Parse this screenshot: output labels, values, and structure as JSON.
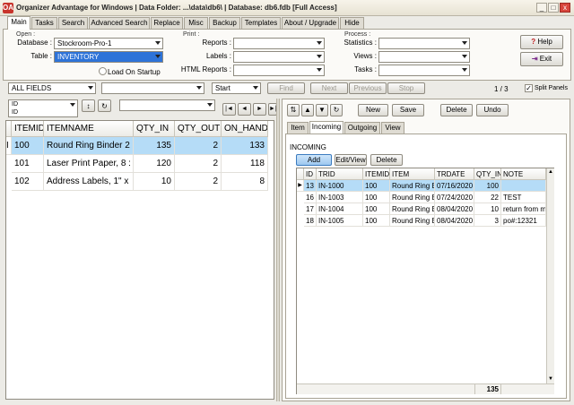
{
  "window": {
    "title": "Organizer Advantage for Windows | Data Folder: ...\\data\\db6\\ | Database: db6.fdb [Full Access]",
    "app_icon": "OA",
    "minimize": "_",
    "maximize": "□",
    "close": "x"
  },
  "tabs": [
    "Main",
    "Tasks",
    "Search",
    "Advanced Search",
    "Replace",
    "Misc",
    "Backup",
    "Templates",
    "About / Upgrade",
    "Hide"
  ],
  "main_panel": {
    "open_group": "Open :",
    "database_label": "Database :",
    "database_value": "Stockroom-Pro-1",
    "table_label": "Table :",
    "table_value": "INVENTORY",
    "load_on_startup": "Load On Startup",
    "print_group": "Print :",
    "reports_label": "Reports :",
    "labels_label": "Labels :",
    "html_reports_label": "HTML Reports :",
    "process_group": "Process :",
    "statistics_label": "Statistics :",
    "views_label": "Views :",
    "tasks_label": "Tasks :",
    "help_button": "Help",
    "exit_button": "Exit"
  },
  "search_bar": {
    "field_value": "ALL FIELDS",
    "match_value": "Start",
    "find": "Find",
    "next": "Next",
    "previous": "Previous",
    "stop": "Stop",
    "record_count": "1 / 3",
    "split_panels": "Split Panels"
  },
  "sort_bar": {
    "sort_field": "ID",
    "sort_field_sub": "ID",
    "sort_dir": "↕",
    "refresh": "↻"
  },
  "nav": {
    "first": "|◄",
    "prev": "◄",
    "next": "►",
    "last": "►|"
  },
  "inventory_grid": {
    "columns": [
      "ITEMID",
      "ITEMNAME",
      "QTY_IN",
      "QTY_OUT",
      "ON_HAND"
    ],
    "rows": [
      {
        "marker": "I",
        "itemid": "100",
        "itemname": "Round Ring Binder 2",
        "qty_in": "135",
        "qty_out": "2",
        "on_hand": "133"
      },
      {
        "marker": "",
        "itemid": "101",
        "itemname": "Laser Print Paper, 8 :",
        "qty_in": "120",
        "qty_out": "2",
        "on_hand": "118"
      },
      {
        "marker": "",
        "itemid": "102",
        "itemname": "Address Labels, 1\" x",
        "qty_in": "10",
        "qty_out": "2",
        "on_hand": "8"
      }
    ]
  },
  "record_toolbar": {
    "new": "New",
    "save": "Save",
    "delete": "Delete",
    "undo": "Undo"
  },
  "detail_tabs": [
    "Item",
    "Incoming",
    "Outgoing",
    "View"
  ],
  "incoming": {
    "section_title": "INCOMING",
    "add": "Add",
    "edit_view": "Edit/View",
    "delete": "Delete",
    "columns": [
      "ID",
      "TRID",
      "ITEMID",
      "ITEM",
      "TRDATE",
      "QTY_IN",
      "NOTE"
    ],
    "rows": [
      {
        "id": "13",
        "trid": "IN-1000",
        "itemid": "100",
        "item": "Round Ring B",
        "trdate": "07/16/2020",
        "qty_in": "100",
        "note": ""
      },
      {
        "id": "16",
        "trid": "IN-1003",
        "itemid": "100",
        "item": "Round Ring B",
        "trdate": "07/24/2020",
        "qty_in": "22",
        "note": "TEST"
      },
      {
        "id": "17",
        "trid": "IN-1004",
        "itemid": "100",
        "item": "Round Ring B",
        "trdate": "08/04/2020",
        "qty_in": "10",
        "note": "return from m"
      },
      {
        "id": "18",
        "trid": "IN-1005",
        "itemid": "100",
        "item": "Round Ring B",
        "trdate": "08/04/2020",
        "qty_in": "3",
        "note": "po#:12321"
      }
    ],
    "total_qty_in": "135"
  }
}
